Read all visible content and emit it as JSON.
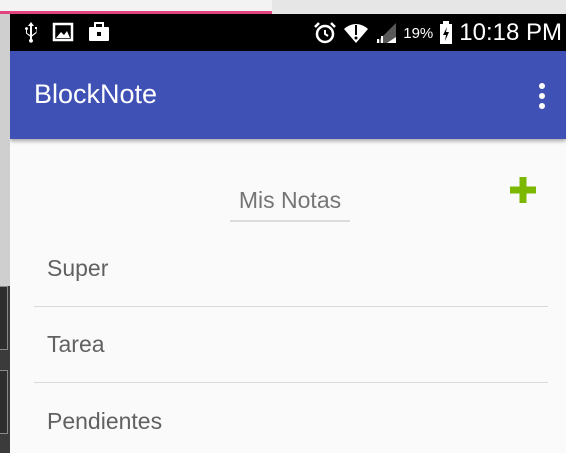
{
  "status_bar": {
    "battery_percent": "19%",
    "time": "10:18 PM",
    "icons": [
      "usb-icon",
      "image-icon",
      "briefcase-icon",
      "alarm-icon",
      "wifi-icon",
      "signal-icon",
      "battery-charging-icon"
    ]
  },
  "app_bar": {
    "title": "BlockNote",
    "menu_icon": "overflow-menu-icon",
    "color": "#3f51b5"
  },
  "main": {
    "section_title": "Mis Notas",
    "add_icon": "plus-icon",
    "add_color": "#7cb800",
    "notes": [
      {
        "title": "Super"
      },
      {
        "title": "Tarea"
      },
      {
        "title": "Pendientes"
      }
    ]
  }
}
